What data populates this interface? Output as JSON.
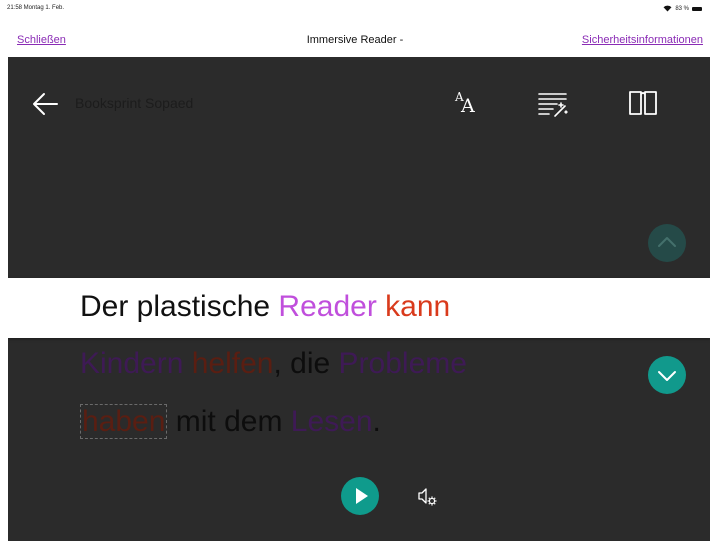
{
  "status_bar": {
    "time": "21:58  Montag 1. Feb.",
    "battery": "83 %",
    "icons": [
      "wifi-icon",
      "battery-icon"
    ]
  },
  "nav": {
    "close_label": "Schließen",
    "title": "Immersive Reader -",
    "safety_label": "Sicherheitsinformationen"
  },
  "reader": {
    "document_title": "Booksprint Sopaed",
    "toolbar_icons": [
      "back-arrow-icon",
      "text-preferences-icon",
      "grammar-options-icon",
      "reading-preferences-icon"
    ],
    "text_pref_glyph_small": "A",
    "text_pref_glyph_big": "A",
    "focus_line": {
      "w1": "Der plastische ",
      "w2": "Reader",
      "w3": " ",
      "w4": "kann"
    },
    "line_2": {
      "w1": "Kindern",
      "w2": " ",
      "w3": "helfen",
      "w4": ", die ",
      "w5": "Probleme"
    },
    "line_3": {
      "w1": "haben",
      "w2": " mit dem ",
      "w3": "Lesen",
      "w4": "."
    },
    "colors": {
      "background": "#2b2b2b",
      "noun": "#c04fdc",
      "verb": "#d93a1c",
      "accent": "#11998c"
    },
    "controls": [
      "scroll-up-icon",
      "scroll-down-icon",
      "play-icon",
      "voice-settings-icon"
    ]
  }
}
